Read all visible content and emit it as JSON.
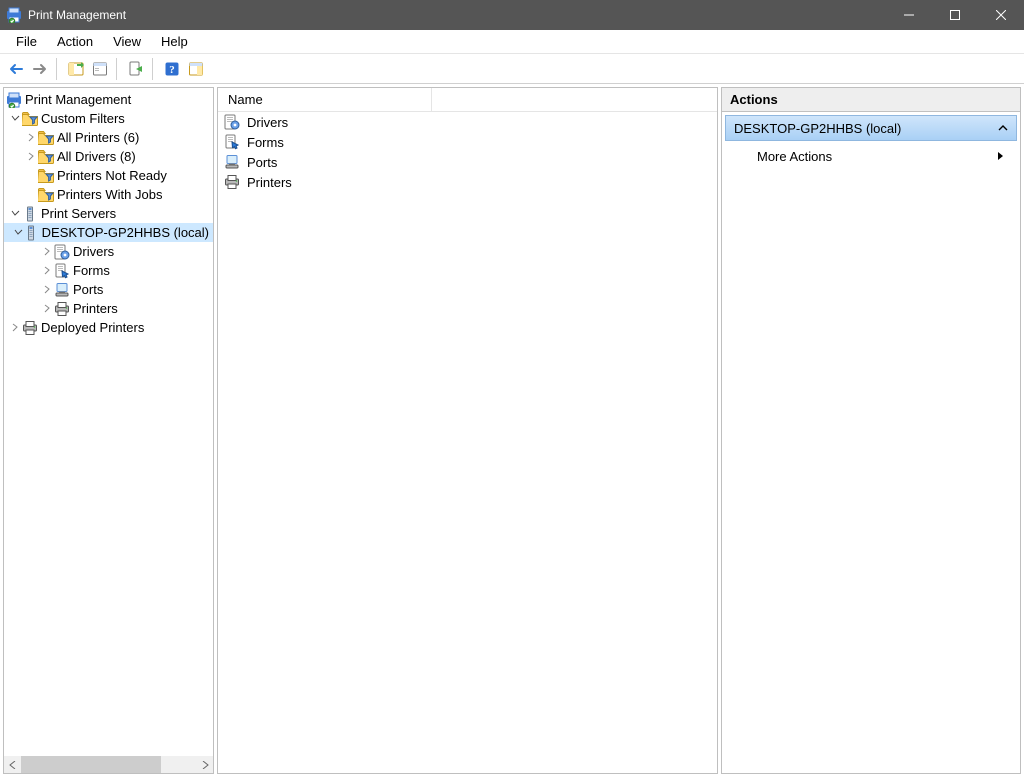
{
  "window": {
    "title": "Print Management"
  },
  "menus": {
    "file": "File",
    "action": "Action",
    "view": "View",
    "help": "Help"
  },
  "tree": {
    "root": "Print Management",
    "custom_filters": "Custom Filters",
    "all_printers": "All Printers (6)",
    "all_drivers": "All Drivers (8)",
    "printers_not_ready": "Printers Not Ready",
    "printers_with_jobs": "Printers With Jobs",
    "print_servers": "Print Servers",
    "server_local": "DESKTOP-GP2HHBS (local)",
    "drivers": "Drivers",
    "forms": "Forms",
    "ports": "Ports",
    "printers": "Printers",
    "deployed_printers": "Deployed Printers"
  },
  "list": {
    "col_name": "Name",
    "items": [
      {
        "label": "Drivers"
      },
      {
        "label": "Forms"
      },
      {
        "label": "Ports"
      },
      {
        "label": "Printers"
      }
    ]
  },
  "actions": {
    "title": "Actions",
    "group": "DESKTOP-GP2HHBS (local)",
    "more": "More Actions"
  }
}
